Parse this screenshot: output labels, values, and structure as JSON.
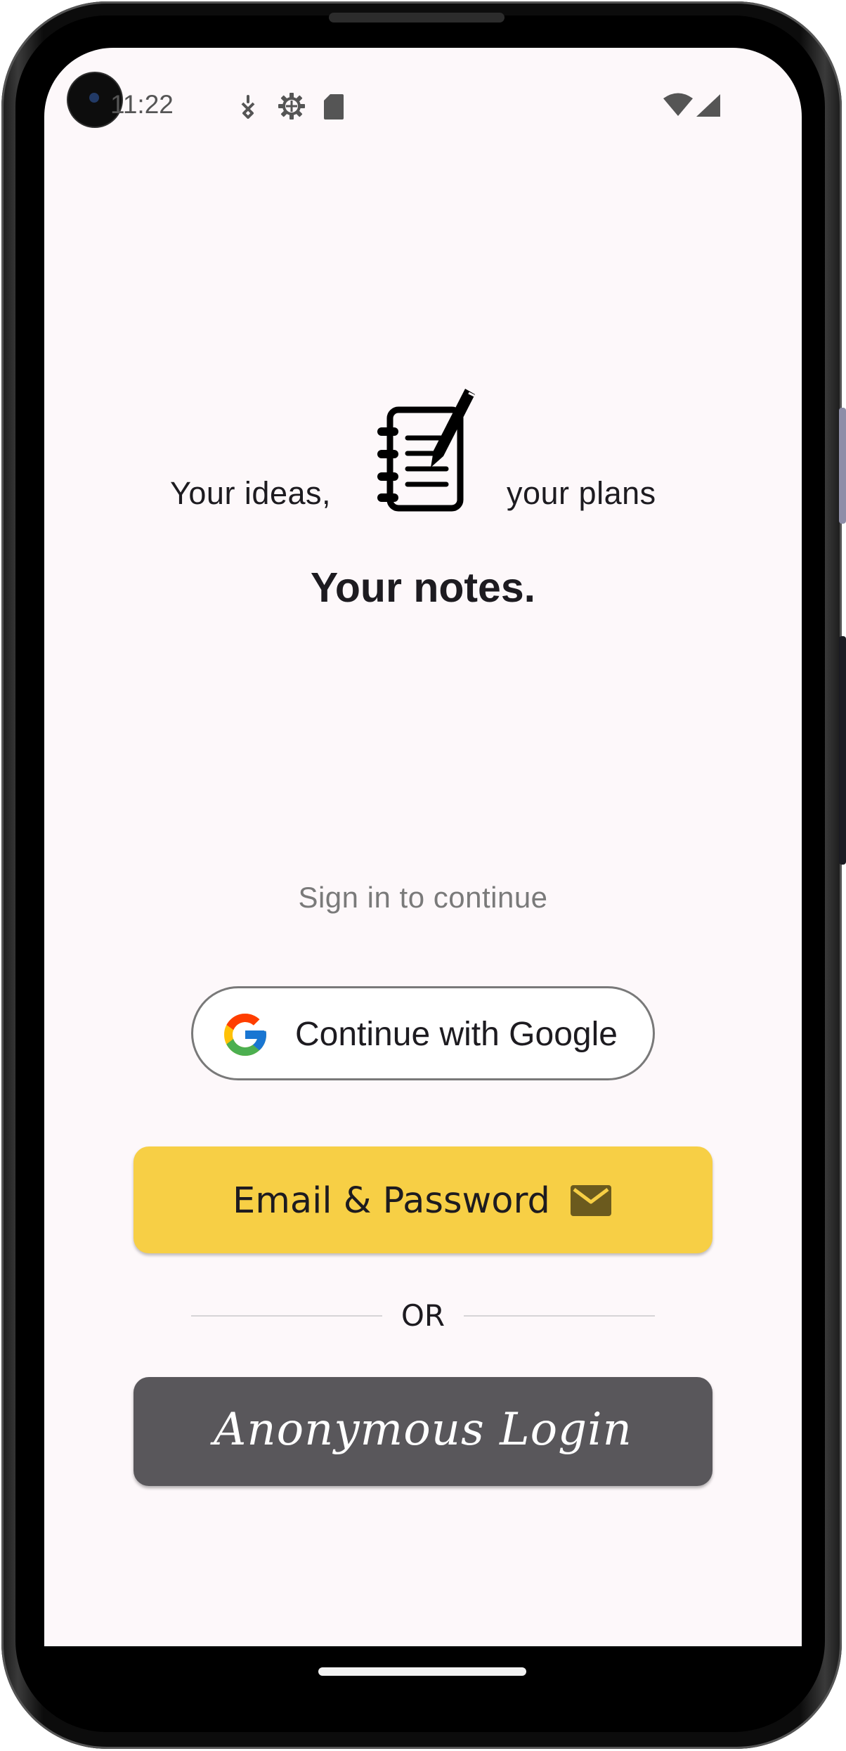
{
  "status_bar": {
    "time": "11:22",
    "icons": [
      "location-icon",
      "settings-gear-icon",
      "sd-card-icon",
      "wifi-icon",
      "cell-signal-icon"
    ]
  },
  "hero": {
    "line_left": "Your ideas,",
    "line_right": "your plans",
    "title": "Your notes.",
    "icon": "notebook-pen-icon"
  },
  "auth": {
    "prompt": "Sign in to continue",
    "google_label": "Continue with Google",
    "email_label": "Email & Password",
    "divider_text": "OR",
    "anonymous_label": "Anonymous Login"
  },
  "colors": {
    "screen_bg": "#fdf8fa",
    "email_button": "#f7cf45",
    "anonymous_button": "#59575b",
    "google_border": "#797979"
  }
}
